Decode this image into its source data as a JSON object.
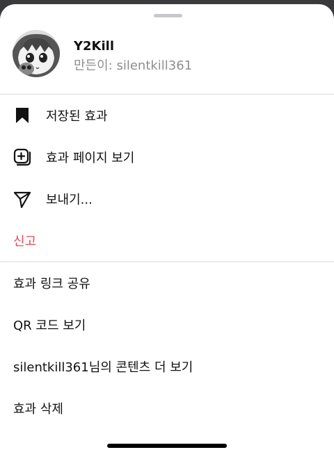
{
  "profile": {
    "name": "Y2Kill",
    "creator_line": "만든이: silentkill361"
  },
  "menu": {
    "saved_effects": {
      "label": "저장된 효과",
      "icon": "bookmark-icon"
    },
    "view_effect_page": {
      "label": "효과 페이지 보기",
      "icon": "effect-page-icon"
    },
    "send": {
      "label": "보내기...",
      "icon": "send-icon"
    },
    "report": {
      "label": "신고",
      "color": "#ed4956"
    }
  },
  "secondary_menu": {
    "share_link": {
      "label": "효과 링크 공유"
    },
    "qr_code": {
      "label": "QR 코드 보기"
    },
    "more_content": {
      "label": "silentkill361님의 콘텐츠 더 보기"
    },
    "delete_effect": {
      "label": "효과 삭제"
    }
  },
  "colors": {
    "danger": "#ed4956",
    "secondary_text": "#8e8e8e"
  }
}
